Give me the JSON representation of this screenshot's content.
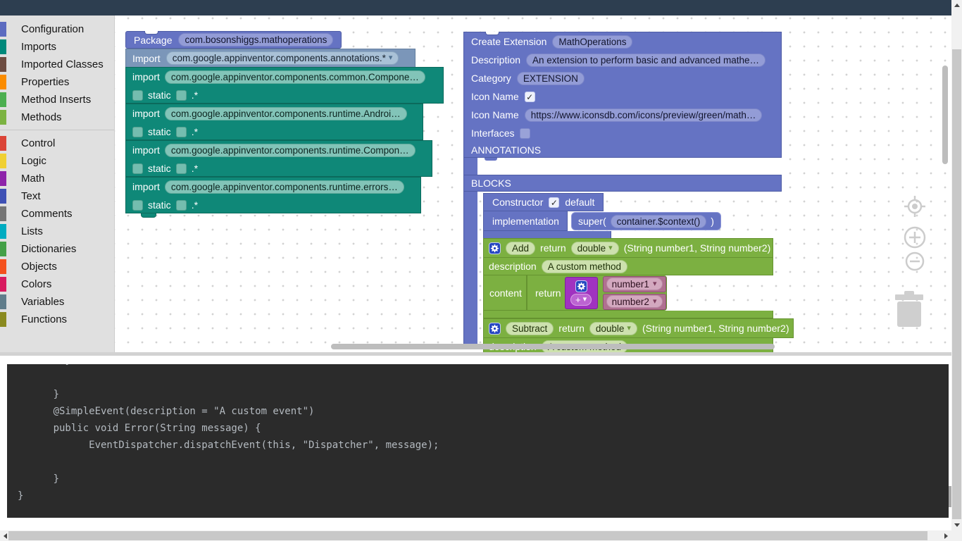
{
  "sidebar": {
    "groups": [
      {
        "items": [
          {
            "label": "Configuration",
            "color": "#5c6bc0"
          },
          {
            "label": "Imports",
            "color": "#00897b"
          },
          {
            "label": "Imported Classes",
            "color": "#6d4c41"
          },
          {
            "label": "Properties",
            "color": "#fb8c00"
          },
          {
            "label": "Method Inserts",
            "color": "#4caf50"
          },
          {
            "label": "Methods",
            "color": "#7cb342"
          }
        ]
      },
      {
        "items": [
          {
            "label": "Control",
            "color": "#db4437"
          },
          {
            "label": "Logic",
            "color": "#f0d033"
          },
          {
            "label": "Math",
            "color": "#8e24aa"
          },
          {
            "label": "Text",
            "color": "#3f51b5"
          },
          {
            "label": "Comments",
            "color": "#757575"
          },
          {
            "label": "Lists",
            "color": "#00acc1"
          },
          {
            "label": "Dictionaries",
            "color": "#43a047"
          },
          {
            "label": "Objects",
            "color": "#f4511e"
          },
          {
            "label": "Colors",
            "color": "#d81b60"
          },
          {
            "label": "Variables",
            "color": "#607d8b"
          },
          {
            "label": "Functions",
            "color": "#8a8a1f"
          }
        ]
      }
    ]
  },
  "workspace": {
    "package_block": {
      "label": "Package",
      "value": "com.bosonshiggs.mathoperations"
    },
    "import_dropdown_block": {
      "label": "Import",
      "value": "com.google.appinventor.components.annotations.*"
    },
    "import_blocks": [
      {
        "label": "import",
        "value": "com.google.appinventor.components.common.Compone…",
        "static_label": "static",
        "suffix": ".*"
      },
      {
        "label": "import",
        "value": "com.google.appinventor.components.runtime.Androi…",
        "static_label": "static",
        "suffix": ".*"
      },
      {
        "label": "import",
        "value": "com.google.appinventor.components.runtime.Compon…",
        "static_label": "static",
        "suffix": ".*"
      },
      {
        "label": "import",
        "value": "com.google.appinventor.components.runtime.errors…",
        "static_label": "static",
        "suffix": ".*"
      }
    ],
    "extension_block": {
      "title_label": "Create Extension",
      "title_value": "MathOperations",
      "description_label": "Description",
      "description_value": "An extension to perform basic and advanced mathe…",
      "category_label": "Category",
      "category_value": "EXTENSION",
      "icon_check_label": "Icon Name",
      "icon_url_label": "Icon Name",
      "icon_url_value": "https://www.iconsdb.com/icons/preview/green/math…",
      "interfaces_label": "Interfaces",
      "annotations_label": "ANNOTATIONS",
      "blocks_label": "BLOCKS"
    },
    "constructor_block": {
      "label": "Constructor",
      "default_label": "default",
      "implementation_label": "implementation",
      "super_prefix": "super(",
      "super_value": "container.$context()",
      "super_suffix": ")"
    },
    "methods": [
      {
        "name": "Add",
        "return_label": "return",
        "return_type": "double",
        "signature": "(String number1, String number2)",
        "description_label": "description",
        "description_value": "A custom method",
        "content_label": "content",
        "content_return_label": "return",
        "operator": "+",
        "arg1": "number1",
        "arg2": "number2"
      },
      {
        "name": "Subtract",
        "return_label": "return",
        "return_type": "double",
        "signature": "(String number1, String number2)",
        "description_label": "description",
        "description_value": "A custom method"
      }
    ]
  },
  "code_panel": {
    "lines": [
      "        }",
      "",
      "      }",
      "      @SimpleEvent(description = \"A custom event\")",
      "      public void Error(String message) {",
      "            EventDispatcher.dispatchEvent(this, \"Dispatcher\", message);",
      "",
      "      }",
      "}"
    ]
  },
  "colors": {
    "topbar": "#2d3e50",
    "sidebar_bg": "#e0e0e0",
    "workspace_bg": "#ffffff",
    "indigo_block": "#6573c3",
    "steel_import_block": "#7b96b9",
    "teal_import_block": "#0f8878",
    "method_block": "#7cb041",
    "purple_block": "#a032c0",
    "variable_block": "#b07090",
    "code_bg": "#2b2b2b",
    "code_text": "#b4bac0"
  }
}
